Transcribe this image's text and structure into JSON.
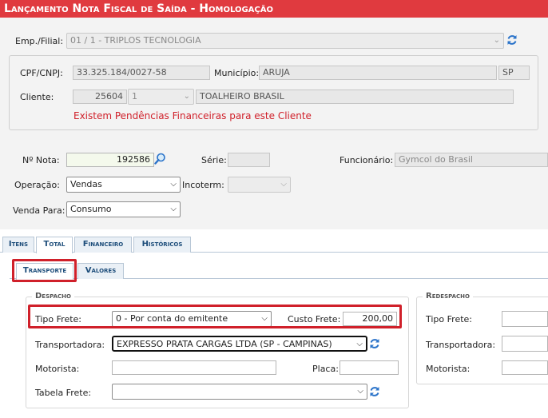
{
  "title": "Lançamento Nota Fiscal de Saída  - Homologação",
  "header": {
    "emp_label": "Emp./Filial:",
    "emp_value": "01 / 1 - TRIPLOS TECNOLOGIA",
    "cpf_label": "CPF/CNPJ:",
    "cpf_value": "33.325.184/0027-58",
    "municipio_label": "Município:",
    "municipio_value": "ARUJA",
    "uf_value": "SP",
    "cliente_label": "Cliente:",
    "cliente_code": "25604",
    "cliente_seq": "1",
    "cliente_name": "TOALHEIRO BRASIL",
    "warning": "Existem Pendências Financeiras para este Cliente"
  },
  "nota": {
    "nota_label": "Nº Nota:",
    "nota_value": "192586",
    "serie_label": "Série:",
    "serie_value": "",
    "funcionario_label": "Funcionário:",
    "funcionario_value": "Gymcol do Brasil",
    "operacao_label": "Operação:",
    "operacao_value": "Vendas",
    "incoterm_label": "Incoterm:",
    "incoterm_value": "",
    "venda_label": "Venda Para:",
    "venda_value": "Consumo"
  },
  "tabs": [
    {
      "label": "Itens"
    },
    {
      "label": "Total"
    },
    {
      "label": "Financeiro"
    },
    {
      "label": "Históricos"
    }
  ],
  "subtabs": [
    {
      "label": "Transporte"
    },
    {
      "label": "Valores"
    }
  ],
  "despacho": {
    "legend": "Despacho",
    "tipo_frete_label": "Tipo Frete:",
    "tipo_frete_value": "0 - Por conta do emitente",
    "custo_frete_label": "Custo Frete:",
    "custo_frete_value": "200,00",
    "transportadora_label": "Transportadora:",
    "transportadora_value": "EXPRESSO PRATA CARGAS LTDA (SP - CAMPINAS)",
    "motorista_label": "Motorista:",
    "motorista_value": "",
    "placa_label": "Placa:",
    "placa_value": "",
    "tabela_frete_label": "Tabela Frete:",
    "tabela_frete_value": ""
  },
  "redespacho": {
    "legend": "Redespacho",
    "tipo_frete_label": "Tipo Frete:",
    "transportadora_label": "Transportadora:",
    "motorista_label": "Motorista:"
  },
  "colors": {
    "title_bg": "#e03a3f",
    "warning": "#d0202a",
    "tab_text": "#1d4d7a",
    "highlight_box": "#d0202a"
  },
  "icons": {
    "search": "magnifier-icon",
    "refresh": "refresh-icon"
  }
}
